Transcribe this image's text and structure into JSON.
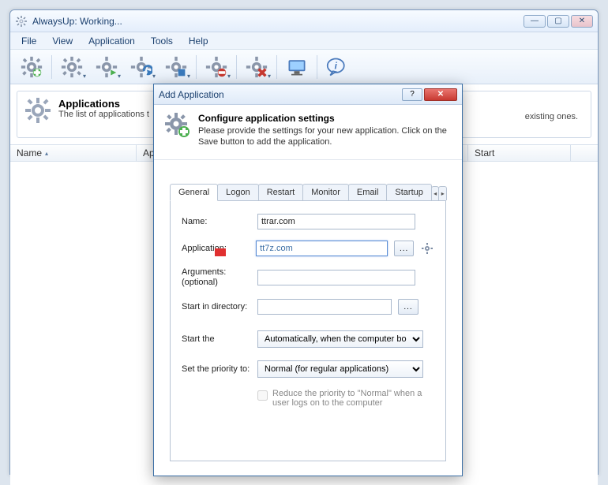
{
  "window": {
    "title": "AlwaysUp: Working..."
  },
  "menu": {
    "file": "File",
    "view": "View",
    "application": "Application",
    "tools": "Tools",
    "help": "Help"
  },
  "info_panel": {
    "heading": "Applications",
    "desc_left": "The list of applications t",
    "desc_right": "existing ones."
  },
  "columns": {
    "name": "Name",
    "app": "Ap",
    "start": "Start"
  },
  "dialog": {
    "title": "Add Application",
    "header_title": "Configure application settings",
    "header_desc": "Please provide the settings for your new application. Click on the Save button to add the application.",
    "tabs": {
      "general": "General",
      "logon": "Logon",
      "restart": "Restart",
      "monitor": "Monitor",
      "email": "Email",
      "startup": "Startup"
    },
    "form": {
      "name_label": "Name:",
      "name_value": "ttrar.com",
      "app_label": "Application:",
      "app_value": "tt7z.com",
      "args_label": "Arguments: (optional)",
      "args_value": "",
      "startin_label": "Start in directory:",
      "startin_value": "",
      "start_the_label": "Start the",
      "start_the_value": "Automatically, when the computer bo",
      "priority_label": "Set the priority to:",
      "priority_value": "Normal (for regular applications)",
      "reduce_chk": "Reduce the priority to \"Normal\" when a user logs on to the computer"
    }
  }
}
